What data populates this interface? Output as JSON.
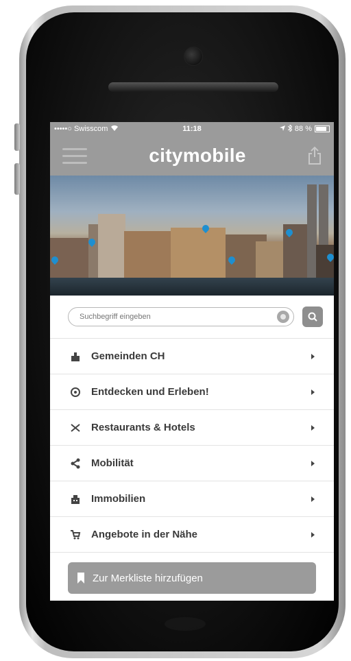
{
  "status_bar": {
    "carrier": "•••••○ Swisscom",
    "time": "11:18",
    "battery": "88 %"
  },
  "nav": {
    "title": "citymobile"
  },
  "search": {
    "placeholder": "Suchbegriff eingeben"
  },
  "menu": {
    "items": [
      {
        "label": "Gemeinden CH",
        "icon": "municipality-icon"
      },
      {
        "label": "Entdecken und Erleben!",
        "icon": "discover-icon"
      },
      {
        "label": "Restaurants & Hotels",
        "icon": "cutlery-icon"
      },
      {
        "label": "Mobilität",
        "icon": "share-route-icon"
      },
      {
        "label": "Immobilien",
        "icon": "building-icon"
      },
      {
        "label": "Angebote in der Nähe",
        "icon": "cart-icon"
      }
    ]
  },
  "bookmark": {
    "label": "Zur Merkliste hirzufügen"
  },
  "colors": {
    "header_gray": "#9b9b9b",
    "map_pin": "#1e8fd0"
  }
}
